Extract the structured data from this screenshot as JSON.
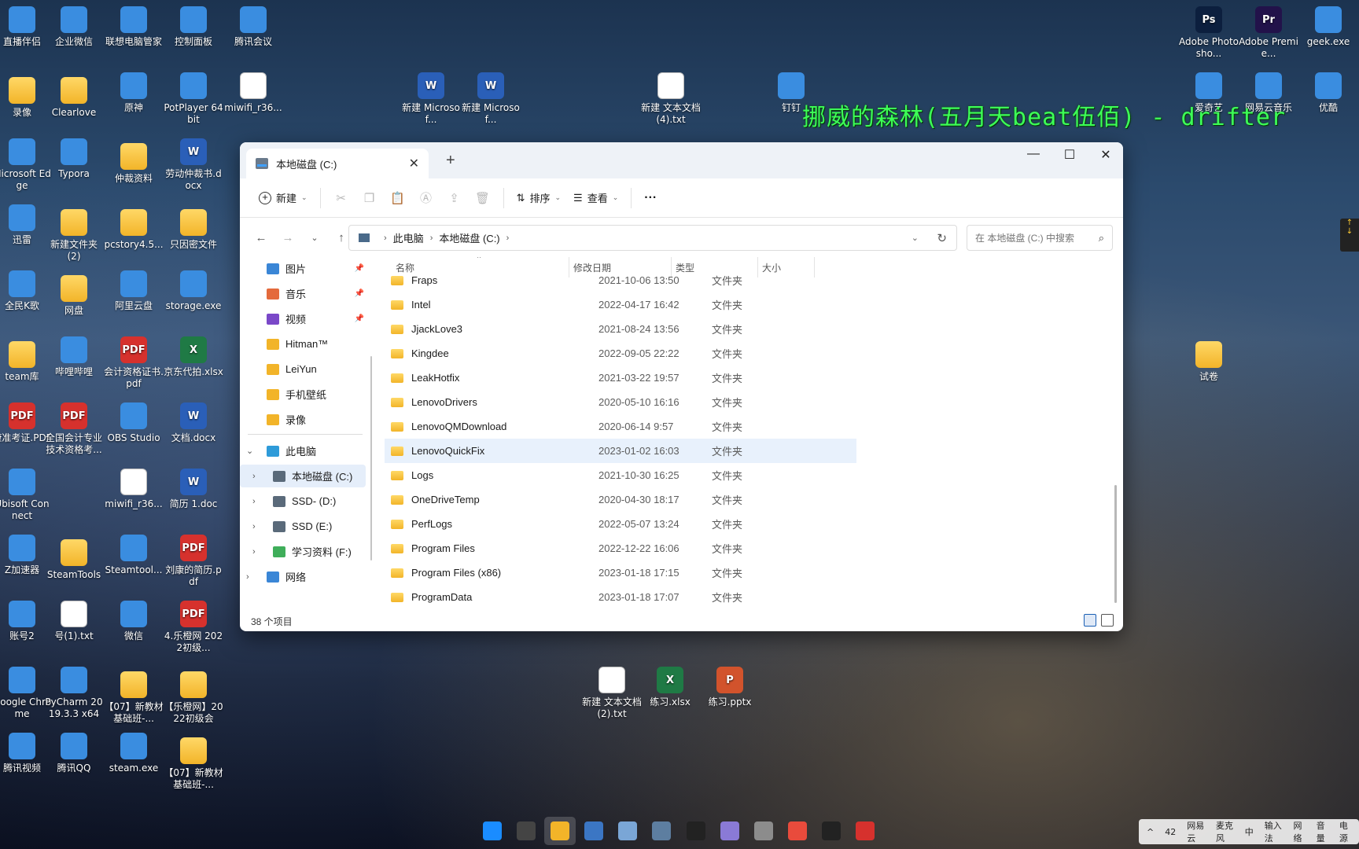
{
  "lyric": "挪威的森林(五月天beat伍佰) - drifter",
  "desktop_icons": [
    {
      "label": "直播伴侣",
      "icon": "live-app"
    },
    {
      "label": "企业微信",
      "icon": "wecom"
    },
    {
      "label": "联想电脑管家",
      "icon": "lenovo-manager"
    },
    {
      "label": "控制面板",
      "icon": "control-panel"
    },
    {
      "label": "腾讯会议",
      "icon": "tencent-meeting"
    },
    {
      "label": "录像",
      "icon": "folder"
    },
    {
      "label": "Clearlove",
      "icon": "folder"
    },
    {
      "label": "原神",
      "icon": "genshin"
    },
    {
      "label": "PotPlayer 64 bit",
      "icon": "potplayer"
    },
    {
      "label": "miwifi_r36...",
      "icon": "document"
    },
    {
      "label": "Microsoft Edge",
      "icon": "edge"
    },
    {
      "label": "Typora",
      "icon": "typora"
    },
    {
      "label": "仲裁资料",
      "icon": "folder"
    },
    {
      "label": "劳动仲裁书.docx",
      "icon": "word"
    },
    {
      "label": "迅雷",
      "icon": "thunder"
    },
    {
      "label": "新建文件夹 (2)",
      "icon": "folder"
    },
    {
      "label": "pcstory4.5...",
      "icon": "folder"
    },
    {
      "label": "只因密文件",
      "icon": "folder"
    },
    {
      "label": "全民K歌",
      "icon": "ksong"
    },
    {
      "label": "网盘",
      "icon": "folder"
    },
    {
      "label": "阿里云盘",
      "icon": "aliyun-drive"
    },
    {
      "label": "storage.exe",
      "icon": "exe"
    },
    {
      "label": "team库",
      "icon": "folder"
    },
    {
      "label": "哔哩哔哩",
      "icon": "bilibili"
    },
    {
      "label": "会计资格证书.pdf",
      "icon": "pdf"
    },
    {
      "label": "京东代拍.xlsx",
      "icon": "excel"
    },
    {
      "label": "康准考证.PDF",
      "icon": "pdf"
    },
    {
      "label": "全国会计专业技术资格考...",
      "icon": "pdf"
    },
    {
      "label": "OBS Studio",
      "icon": "obs"
    },
    {
      "label": "文档.docx",
      "icon": "word"
    },
    {
      "label": "Ubisoft Connect",
      "icon": "ubisoft"
    },
    {
      "label": "miwifi_r36...",
      "icon": "document"
    },
    {
      "label": "简历 1.doc",
      "icon": "word"
    },
    {
      "label": "Z加速器",
      "icon": "accelerator"
    },
    {
      "label": "SteamTools",
      "icon": "folder"
    },
    {
      "label": "Steamtool...",
      "icon": "steamtool"
    },
    {
      "label": "刘康的简历.pdf",
      "icon": "pdf"
    },
    {
      "label": "账号2",
      "icon": "steam"
    },
    {
      "label": "号(1).txt",
      "icon": "document"
    },
    {
      "label": "微信",
      "icon": "wechat"
    },
    {
      "label": "4.乐橙网 2022初级...",
      "icon": "pdf"
    },
    {
      "label": "Google Chrome",
      "icon": "chrome"
    },
    {
      "label": "PyCharm 2019.3.3 x64",
      "icon": "pycharm"
    },
    {
      "label": "【07】新教材基础班-...",
      "icon": "folder"
    },
    {
      "label": "【乐橙网】2022初级会",
      "icon": "folder"
    },
    {
      "label": "腾讯视频",
      "icon": "tencent-video"
    },
    {
      "label": "腾讯QQ",
      "icon": "qq"
    },
    {
      "label": "steam.exe",
      "icon": "steam"
    },
    {
      "label": "【07】新教材基础班-...",
      "icon": "folder"
    },
    {
      "label": "新建 Microsof...",
      "icon": "word"
    },
    {
      "label": "新建 Microsof...",
      "icon": "word"
    },
    {
      "label": "新建 文本文档 (4).txt",
      "icon": "document"
    },
    {
      "label": "钉钉",
      "icon": "dingtalk"
    },
    {
      "label": "Adobe Photosho...",
      "icon": "photoshop"
    },
    {
      "label": "Adobe Premie...",
      "icon": "premiere"
    },
    {
      "label": "geek.exe",
      "icon": "geek"
    },
    {
      "label": "爱奇艺",
      "icon": "iqiyi"
    },
    {
      "label": "网易云音乐",
      "icon": "netease-music"
    },
    {
      "label": "优酷",
      "icon": "youku"
    },
    {
      "label": "试卷",
      "icon": "folder"
    },
    {
      "label": "新建 文本文档 (2).txt",
      "icon": "document"
    },
    {
      "label": "练习.xlsx",
      "icon": "excel"
    },
    {
      "label": "练习.pptx",
      "icon": "ppt"
    }
  ],
  "explorer": {
    "tab_title": "本地磁盘 (C:)",
    "toolbar": {
      "new_label": "新建",
      "sort_label": "排序",
      "view_label": "查看",
      "more_label": "···"
    },
    "breadcrumb": [
      "此电脑",
      "本地磁盘 (C:)"
    ],
    "search_placeholder": "在 本地磁盘 (C:) 中搜索",
    "nav": {
      "quick": [
        {
          "label": "图片",
          "pinned": true,
          "icon": "pictures-icon"
        },
        {
          "label": "音乐",
          "pinned": true,
          "icon": "music-icon"
        },
        {
          "label": "视频",
          "pinned": true,
          "icon": "videos-icon"
        },
        {
          "label": "Hitman™",
          "pinned": false,
          "icon": "folder-icon"
        },
        {
          "label": "LeiYun",
          "pinned": false,
          "icon": "folder-icon"
        },
        {
          "label": "手机壁纸",
          "pinned": false,
          "icon": "folder-icon"
        },
        {
          "label": "录像",
          "pinned": false,
          "icon": "folder-icon"
        }
      ],
      "this_pc": "此电脑",
      "drives": [
        "本地磁盘 (C:)",
        "SSD- (D:)",
        "SSD (E:)",
        "学习资料 (F:)"
      ],
      "network": "网络"
    },
    "columns": [
      "名称",
      "修改日期",
      "类型",
      "大小"
    ],
    "rows": [
      {
        "name": "Fraps",
        "date": "2021-10-06 13:50",
        "type": "文件夹"
      },
      {
        "name": "Intel",
        "date": "2022-04-17 16:42",
        "type": "文件夹"
      },
      {
        "name": "JjackLove3",
        "date": "2021-08-24 13:56",
        "type": "文件夹"
      },
      {
        "name": "Kingdee",
        "date": "2022-09-05 22:22",
        "type": "文件夹"
      },
      {
        "name": "LeakHotfix",
        "date": "2021-03-22 19:57",
        "type": "文件夹"
      },
      {
        "name": "LenovoDrivers",
        "date": "2020-05-10 16:16",
        "type": "文件夹"
      },
      {
        "name": "LenovoQMDownload",
        "date": "2020-06-14 9:57",
        "type": "文件夹"
      },
      {
        "name": "LenovoQuickFix",
        "date": "2023-01-02 16:03",
        "type": "文件夹",
        "selected": true
      },
      {
        "name": "Logs",
        "date": "2021-10-30 16:25",
        "type": "文件夹"
      },
      {
        "name": "OneDriveTemp",
        "date": "2020-04-30 18:17",
        "type": "文件夹"
      },
      {
        "name": "PerfLogs",
        "date": "2022-05-07 13:24",
        "type": "文件夹"
      },
      {
        "name": "Program Files",
        "date": "2022-12-22 16:06",
        "type": "文件夹"
      },
      {
        "name": "Program Files (x86)",
        "date": "2023-01-18 17:15",
        "type": "文件夹"
      },
      {
        "name": "ProgramData",
        "date": "2023-01-18 17:07",
        "type": "文件夹"
      }
    ],
    "status": "38 个项目"
  },
  "taskbar": [
    {
      "name": "start-icon",
      "color": "#1a8cff"
    },
    {
      "name": "task-view-icon",
      "color": "#444444"
    },
    {
      "name": "file-explorer-icon",
      "color": "#f2b429"
    },
    {
      "name": "python-icon",
      "color": "#3b76c4"
    },
    {
      "name": "photos-icon",
      "color": "#7aa6d6"
    },
    {
      "name": "calculator-icon",
      "color": "#5d7ea0"
    },
    {
      "name": "notion-icon",
      "color": "#222222"
    },
    {
      "name": "app-icon",
      "color": "#8a7ad6"
    },
    {
      "name": "microphone-app-icon",
      "color": "#8c8c8c"
    },
    {
      "name": "chrome-icon",
      "color": "#e94b3c"
    },
    {
      "name": "obs-icon",
      "color": "#222222"
    },
    {
      "name": "netease-music-icon",
      "color": "#d6312d"
    }
  ],
  "tray": {
    "items": [
      "^",
      "42",
      "网易云",
      "麦克风",
      "中",
      "输入法",
      "网络",
      "音量",
      "电源"
    ],
    "lang": "中"
  },
  "colors": {
    "lyric": "#3dff57",
    "selection": "#e8f1fc",
    "accent": "#1a5fb4"
  }
}
